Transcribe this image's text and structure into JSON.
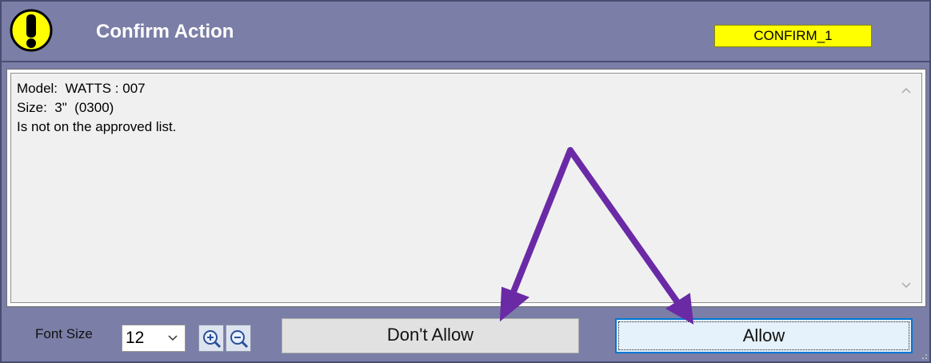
{
  "dialog": {
    "title": "Confirm Action",
    "tag": "CONFIRM_1",
    "icon": "warning-exclamation-icon",
    "colors": {
      "chrome": "#7b7ea6",
      "tag_background": "#ffff00",
      "warning_icon": "#ffff00",
      "annotation_arrows": "#6a2aa6",
      "default_button_border": "#0078d7"
    }
  },
  "message": {
    "lines": [
      "Model:  WATTS : 007",
      "Size:  3\"  (0300)",
      "Is not on the approved list."
    ]
  },
  "footer": {
    "font_size_label": "Font Size",
    "font_size_value": "12",
    "zoom_in_icon": "zoom-in-icon",
    "zoom_out_icon": "zoom-out-icon",
    "dont_allow_label": "Don't Allow",
    "allow_label": "Allow"
  }
}
